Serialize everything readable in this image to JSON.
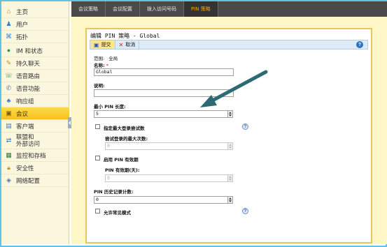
{
  "sidebar": {
    "items": [
      {
        "label": "主页",
        "icon": "home-icon"
      },
      {
        "label": "用户",
        "icon": "user-icon"
      },
      {
        "label": "拓扑",
        "icon": "topology-icon"
      },
      {
        "label": "IM 和状态",
        "icon": "im-presence-icon"
      },
      {
        "label": "持久聊天",
        "icon": "chat-icon"
      },
      {
        "label": "语音路由",
        "icon": "voice-routing-icon"
      },
      {
        "label": "语音功能",
        "icon": "phone-icon"
      },
      {
        "label": "响应组",
        "icon": "response-group-icon"
      },
      {
        "label": "会议",
        "icon": "conference-icon",
        "active": true
      },
      {
        "label": "客户端",
        "icon": "client-icon"
      },
      {
        "label": "联盟和\n外部访问",
        "icon": "federation-icon"
      },
      {
        "label": "监控和存档",
        "icon": "monitoring-icon"
      },
      {
        "label": "安全性",
        "icon": "lock-icon"
      },
      {
        "label": "网络配置",
        "icon": "network-icon"
      }
    ]
  },
  "tabs": [
    {
      "label": "会议策略"
    },
    {
      "label": "会议配置"
    },
    {
      "label": "拨入访问号码"
    },
    {
      "label": "PIN 策略",
      "active": true
    }
  ],
  "panel": {
    "title": "编辑 PIN 策略 - Global",
    "toolbar": {
      "submit_label": "提交",
      "cancel_label": "取消"
    },
    "scope_label": "范围:",
    "scope_value": "全局",
    "name_label": "名称:",
    "name_value": "Global",
    "description_label": "说明:",
    "description_value": "",
    "min_pin_length_label": "最小 PIN 长度:",
    "min_pin_length_value": "5",
    "max_logon_attempts_checkbox_label": "指定最大登录尝试数",
    "max_logon_attempts_label": "尝试登录的最大次数:",
    "max_logon_attempts_value": "0",
    "pin_expiration_checkbox_label": "启用 PIN 有效期",
    "pin_expiration_days_label": "PIN 有效期(天):",
    "pin_expiration_days_value": "0",
    "pin_history_count_label": "PIN 历史记录计数:",
    "pin_history_count_value": "0",
    "allow_common_patterns_label": "允许常见模式"
  },
  "colors": {
    "active_nav": "#f6c21a",
    "tab_bar": "#4a4a4a",
    "active_tab_text": "#f0a800",
    "panel_border": "#e9c65a",
    "content_bg": "#fff6c8",
    "arrow": "#2d6a73"
  }
}
